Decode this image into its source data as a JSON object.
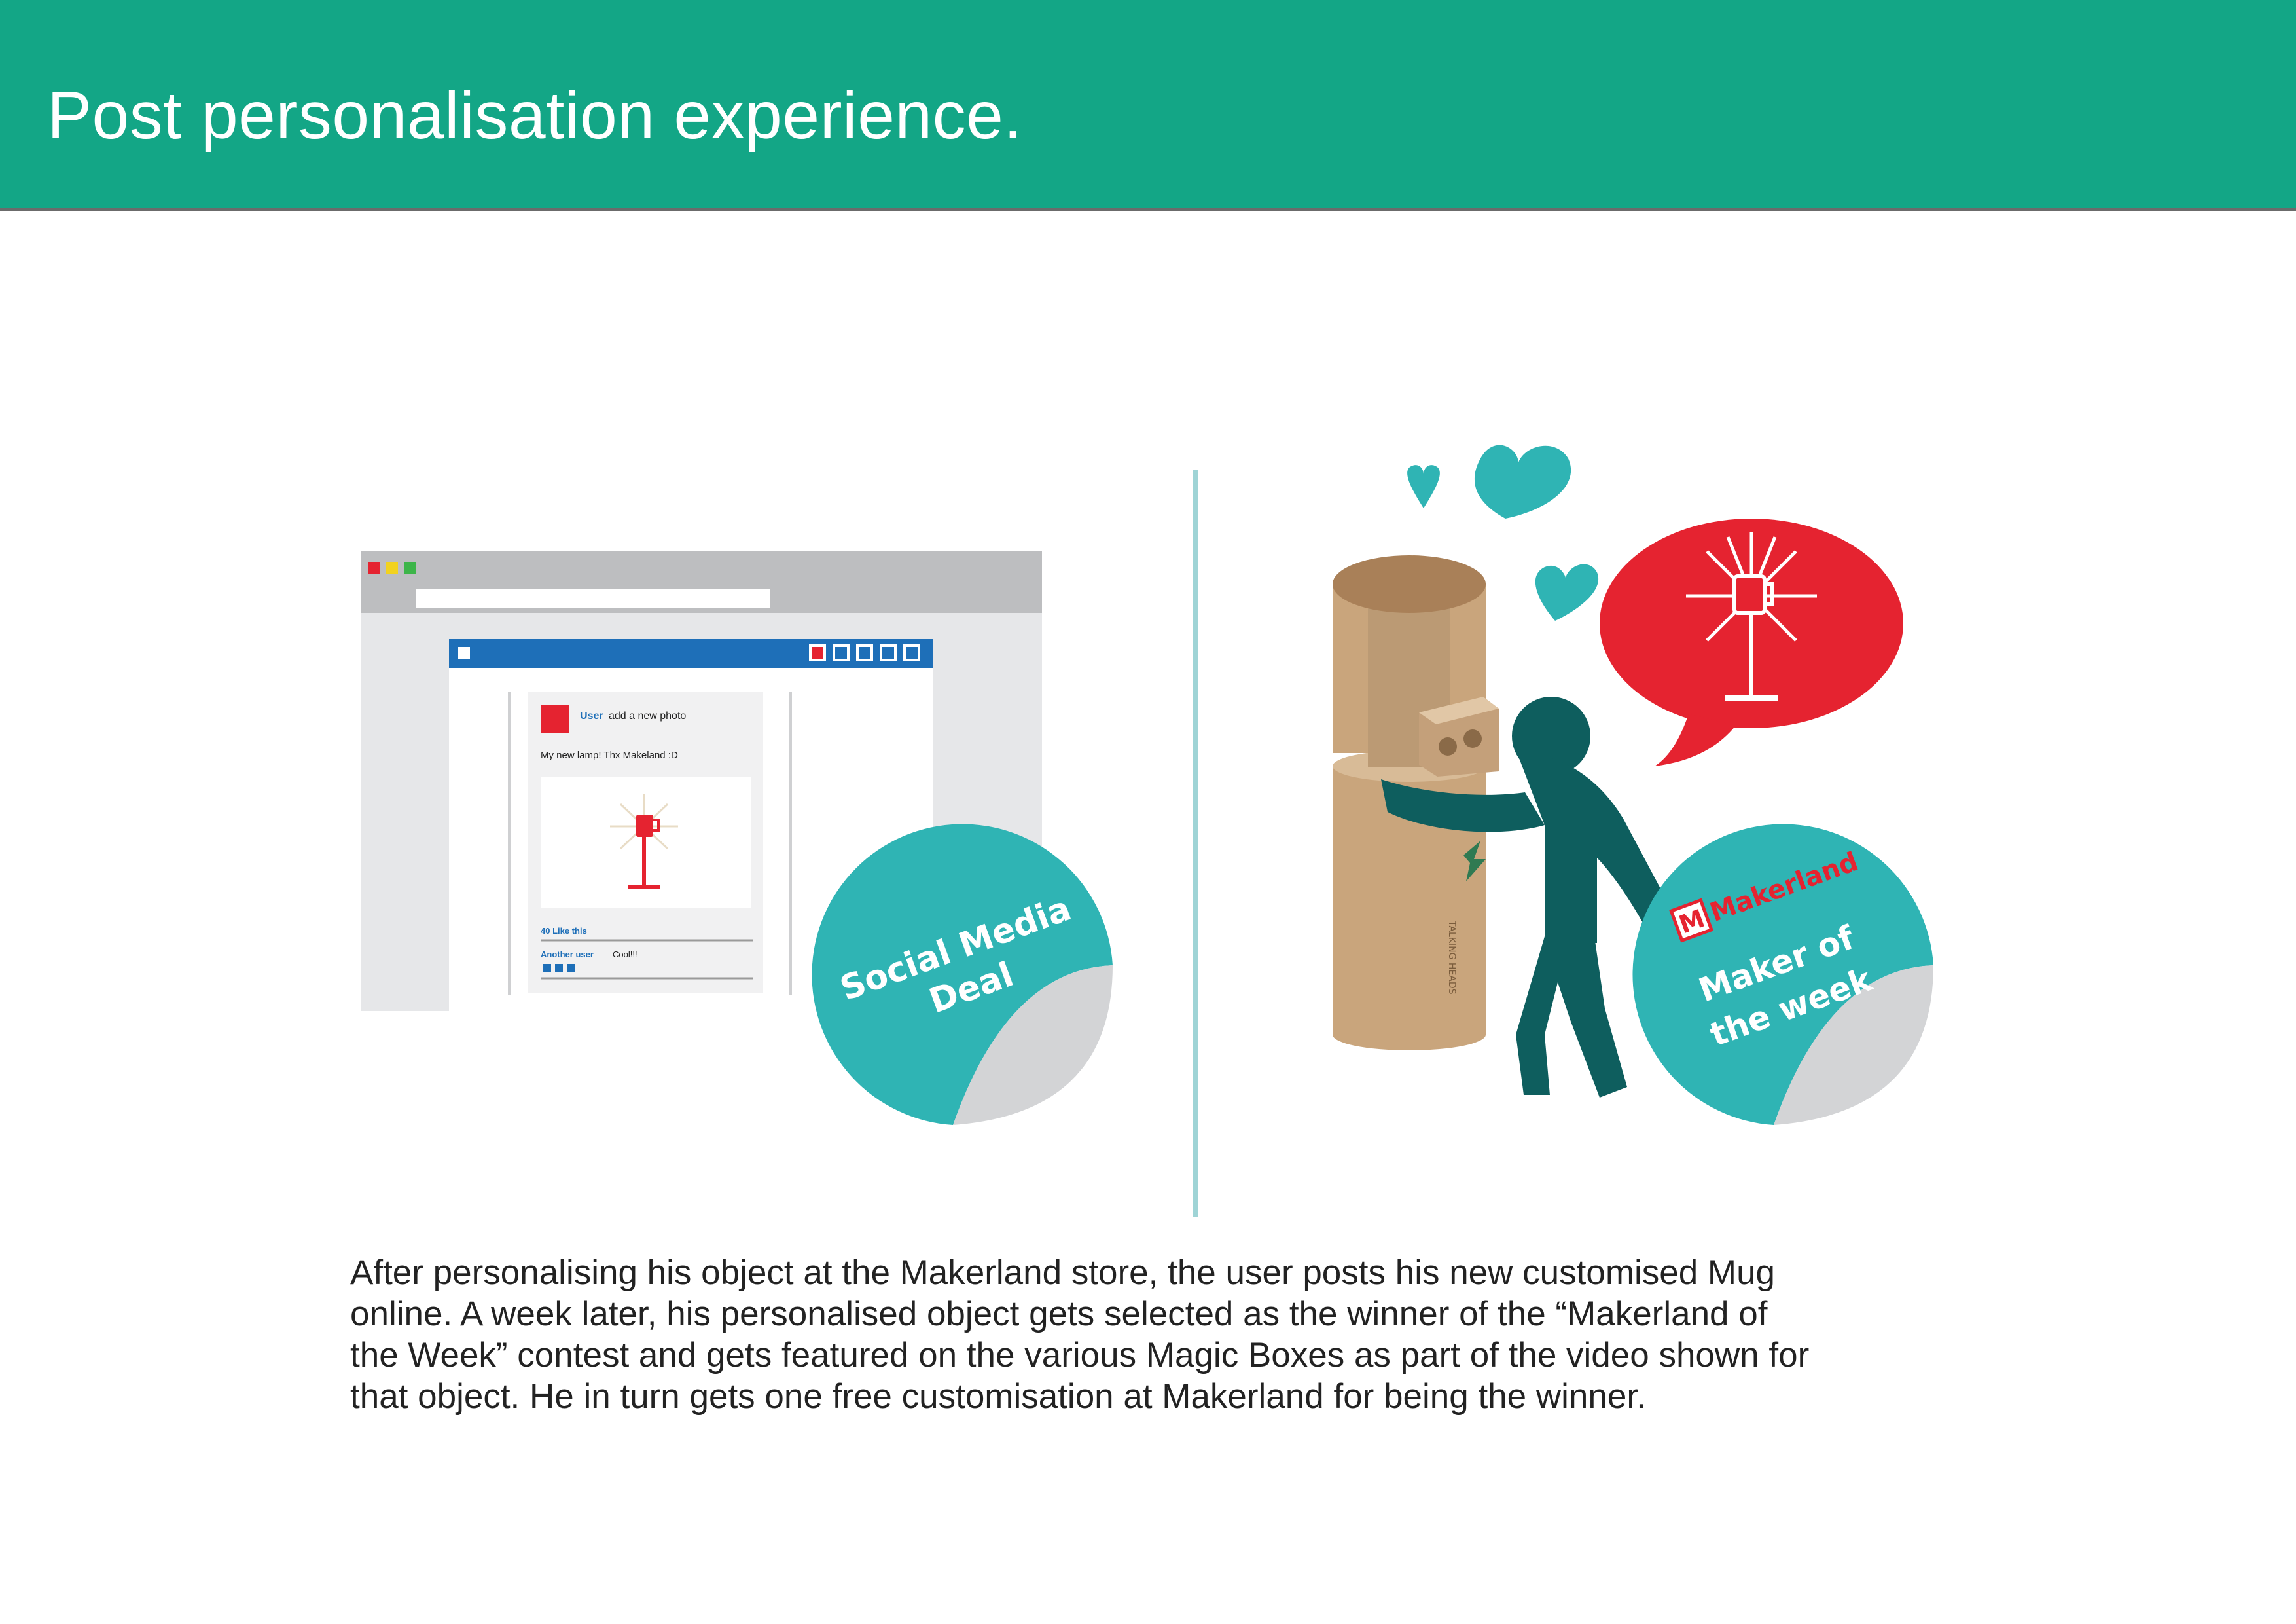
{
  "header": {
    "title": "Post personalisation experience."
  },
  "browser_mockup": {
    "post": {
      "username": "User",
      "action_text": "add a new photo",
      "message": "My new lamp! Thx Makeland :D",
      "likes_text": "40 Like this",
      "comment_user": "Another user",
      "comment_text": "Cool!!!"
    },
    "sticker": {
      "line1": "Social Media",
      "line2": "Deal"
    }
  },
  "magic_box": {
    "box_brand_text": "TALKING HEADS",
    "sticker": {
      "brand": "Makerland",
      "brand_letter": "M",
      "line1": "Maker of",
      "line2": "the week"
    }
  },
  "caption": {
    "line1": "After personalising his object at the Makerland store, the user posts his new customised Mug",
    "line2": "online. A week later, his personalised object gets selected as the winner of the “Makerland of",
    "line3": "the Week” contest and gets featured on the various Magic Boxes as part of the video shown for",
    "line4": "that object. He in turn gets one free customisation at Makerland for being the winner."
  },
  "colors": {
    "header_bg": "#13a686",
    "teal": "#2fb4b4",
    "dark_teal": "#0e5e5e",
    "red": "#e52330",
    "cardboard": "#c9a57c",
    "browser_blue": "#1e6fb8"
  }
}
